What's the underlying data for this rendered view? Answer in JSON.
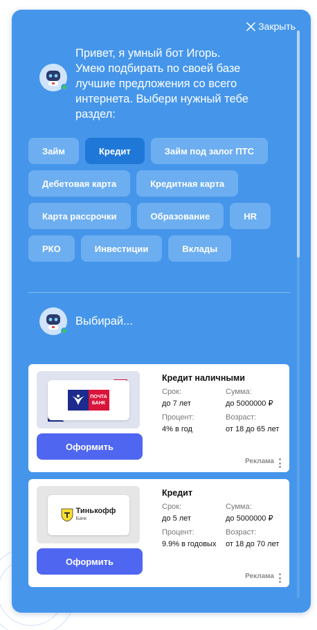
{
  "widget": {
    "close_label": "Закрыть",
    "greeting": "Привет, я умный бот Игорь. Умею подбирать по своей базе лучшие предложения со всего интернета. Выбери нужный тебе раздел:",
    "pick_prompt": "Выбирай...",
    "accent_color": "#4596ea",
    "active_chip_color": "#1f78d8",
    "button_color": "#4f66f0",
    "categories": [
      [
        "Займ",
        "Кредит",
        "Займ под залог ПТС"
      ],
      [
        "Дебетовая карта",
        "Кредитная карта"
      ],
      [
        "Карта рассрочки",
        "Образование",
        "HR"
      ],
      [
        "РКО",
        "Инвестиции",
        "Вклады"
      ]
    ],
    "active_category": "Кредит"
  },
  "offers": [
    {
      "logo": "pochta-bank-logo",
      "logo_text_1": "ПОЧТА",
      "logo_text_2": "БАНК",
      "title": "Кредит наличными",
      "term_label": "Срок:",
      "term_value": "до 7 лет",
      "amount_label": "Сумма:",
      "amount_value": "до 5000000 ₽",
      "rate_label": "Процент:",
      "rate_value": "4% в год",
      "age_label": "Возраст:",
      "age_value": "от 18 до 65 лет",
      "button_label": "Оформить",
      "ad_label": "Реклама"
    },
    {
      "logo": "tinkoff-bank-logo",
      "logo_text_1": "Тинькофф",
      "logo_text_2": "Банк",
      "title": "Кредит",
      "term_label": "Срок:",
      "term_value": "до 5 лет",
      "amount_label": "Сумма:",
      "amount_value": "до 5000000 ₽",
      "rate_label": "Процент:",
      "rate_value": "9.9% в годовых",
      "age_label": "Возраст:",
      "age_value": "от 18 до 70 лет",
      "button_label": "Оформить",
      "ad_label": "Реклама"
    }
  ]
}
